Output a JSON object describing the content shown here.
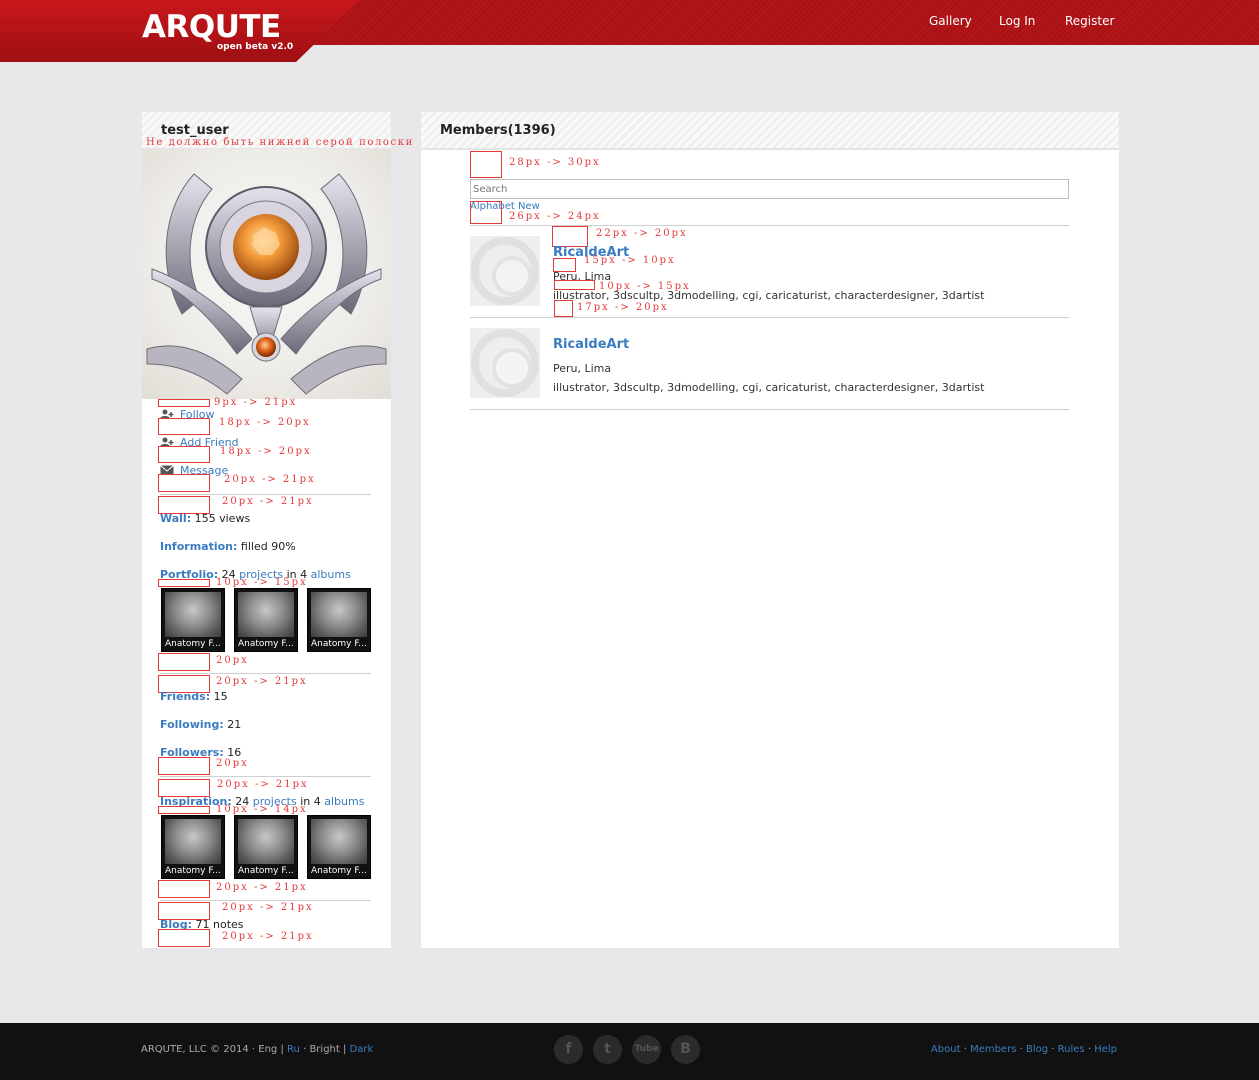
{
  "header": {
    "logo": "ARQUTE",
    "logo_sub": "open beta v2.0",
    "nav": {
      "gallery": "Gallery",
      "login": "Log In",
      "register": "Register"
    }
  },
  "profile": {
    "username": "test_user",
    "avatar_note": "Не должно быть нижней серой полоски",
    "actions": {
      "follow": "Follow",
      "add_friend": "Add Friend",
      "message": "Message"
    },
    "wall": {
      "label": "Wall:",
      "count": "155",
      "suffix": "views"
    },
    "information": {
      "label": "Information:",
      "value": "filled 90%"
    },
    "portfolio": {
      "label": "Portfolio:",
      "count": "24",
      "projects": "projects",
      "in": "in",
      "albums_count": "4",
      "albums": "albums"
    },
    "portfolio_thumbs": [
      "Anatomy F...",
      "Anatomy F...",
      "Anatomy F..."
    ],
    "friends": {
      "label": "Friends:",
      "value": "15"
    },
    "following": {
      "label": "Following:",
      "value": "21"
    },
    "followers": {
      "label": "Followers:",
      "value": "16"
    },
    "inspiration": {
      "label": "Inspiration:",
      "count": "24",
      "projects": "projects",
      "in": "in",
      "albums_count": "4",
      "albums": "albums"
    },
    "inspiration_thumbs": [
      "Anatomy F...",
      "Anatomy F...",
      "Anatomy F..."
    ],
    "blog": {
      "label": "Blog:",
      "count": "71",
      "suffix": "notes"
    },
    "notes": {
      "n1": "9px -> 21px",
      "n2": "18px -> 20px",
      "n3": "18px -> 20px",
      "n4": "20px -> 21px",
      "n5": "20px -> 21px",
      "n6": "10px -> 15px",
      "n7": "20px",
      "n8": "20px -> 21px",
      "n9": "20px",
      "n10": "20px -> 21px",
      "n11": "10px -> 14px",
      "n12": "20px -> 21px",
      "n13": "20px -> 21px",
      "n14": "20px -> 21px"
    }
  },
  "members": {
    "title": "Members(1396)",
    "search_placeholder": "Search",
    "sort": {
      "alphabet": "Alphabet",
      "new": "New"
    },
    "list": [
      {
        "name": "RicaldeArt",
        "location": "Peru, Lima",
        "tags": "illustrator, 3dscultp, 3dmodelling, cgi, caricaturist, characterdesigner, 3dartist"
      },
      {
        "name": "RicaldeArt",
        "location": "Peru, Lima",
        "tags": "illustrator, 3dscultp, 3dmodelling, cgi, caricaturist, characterdesigner, 3dartist"
      }
    ],
    "notes": {
      "m1": "28px -> 30px",
      "m2": "26px -> 24px",
      "m3": "22px -> 20px",
      "m4": "15px -> 10px",
      "m5": "10px -> 15px",
      "m6": "17px -> 20px"
    }
  },
  "footer": {
    "copyright": "ARQUTE, LLC © 2014",
    "dot": "·",
    "pipe": "|",
    "lang_eng": "Eng",
    "lang_ru": "Ru",
    "theme_bright": "Bright",
    "theme_dark": "Dark",
    "links": {
      "about": "About",
      "members": "Members",
      "blog": "Blog",
      "rules": "Rules",
      "help": "Help"
    },
    "social_icons": [
      "facebook-icon",
      "twitter-icon",
      "youtube-icon",
      "vk-icon"
    ],
    "social_glyphs": {
      "facebook": "f",
      "twitter": "t",
      "youtube": "Tube",
      "vk": "B"
    }
  },
  "colors": {
    "brand_red": "#b3161a",
    "link_blue": "#3a7cc0",
    "note_red": "#e33a3a",
    "footer_bg": "#111111"
  }
}
